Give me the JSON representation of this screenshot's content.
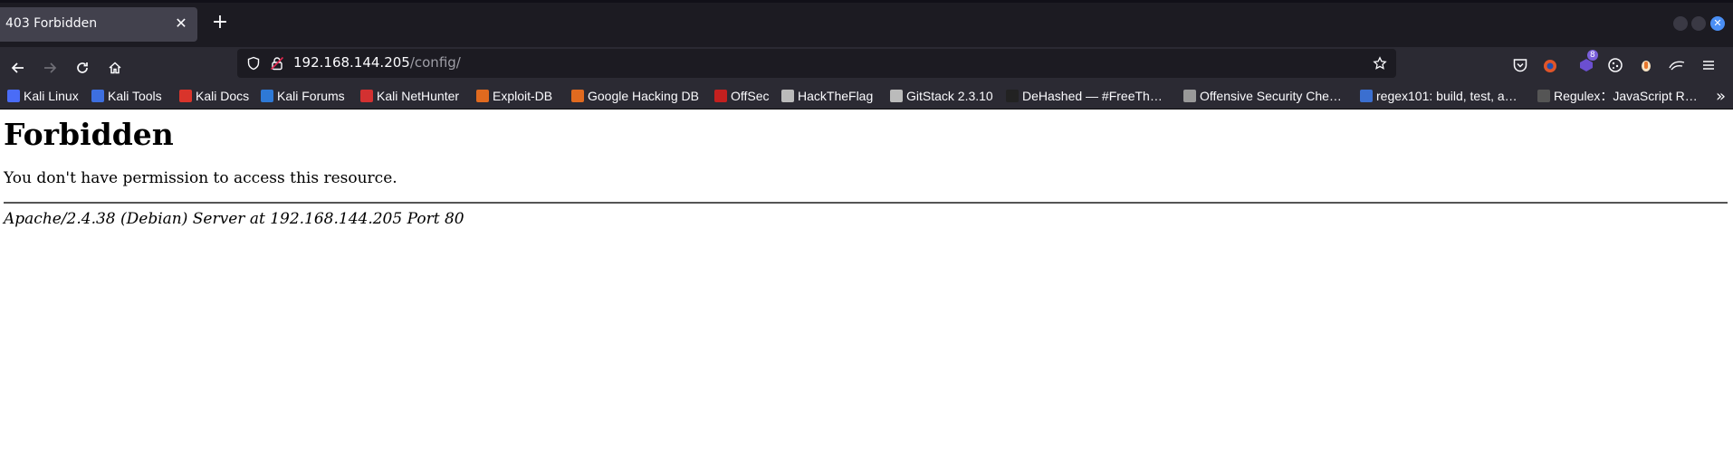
{
  "tab": {
    "title": "403 Forbidden",
    "close_symbol": "✕",
    "new_tab_symbol": "+"
  },
  "url": {
    "host": "192.168.144.205",
    "path": "/config/"
  },
  "bookmarks": [
    {
      "label": "Kali Linux",
      "color": "#4a6cf7"
    },
    {
      "label": "Kali Tools",
      "color": "#3d6fe0"
    },
    {
      "label": "Kali Docs",
      "color": "#d9342b"
    },
    {
      "label": "Kali Forums",
      "color": "#2e79d6"
    },
    {
      "label": "Kali NetHunter",
      "color": "#d33131"
    },
    {
      "label": "Exploit-DB",
      "color": "#e06a1f"
    },
    {
      "label": "Google Hacking DB",
      "color": "#e06a1f"
    },
    {
      "label": "OffSec",
      "color": "#c4201f"
    },
    {
      "label": "HackTheFlag",
      "color": "#bbbbbb"
    },
    {
      "label": "GitStack 2.3.10",
      "color": "#bbbbbb"
    },
    {
      "label": "DeHashed — #FreeTh…",
      "color": "#222222"
    },
    {
      "label": "Offensive Security Che…",
      "color": "#999999"
    },
    {
      "label": "regex101: build, test, a…",
      "color": "#3b6fd0"
    },
    {
      "label": "Regulex：JavaScript R…",
      "color": "#555555"
    }
  ],
  "extensions": {
    "badge_count": "8"
  },
  "page": {
    "heading": "Forbidden",
    "message": "You don't have permission to access this resource.",
    "address": "Apache/2.4.38 (Debian) Server at 192.168.144.205 Port 80"
  }
}
